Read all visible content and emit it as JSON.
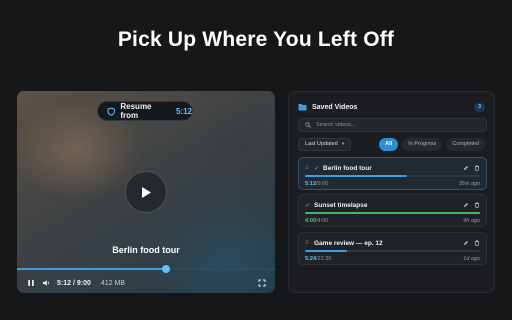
{
  "headline": "Pick Up Where You Left Off",
  "colors": {
    "accent": "#3a9fe0",
    "accent_text": "#5fc1f5",
    "complete": "#3fb56a",
    "background": "#161718"
  },
  "player": {
    "resume_label": "Resume from",
    "resume_time": "5:12",
    "video_title": "Berlin food tour",
    "progress_fraction": 0.578,
    "current_time": "5:12",
    "duration": "9:00",
    "time_separator": " / ",
    "file_size": "412 MB",
    "icons": [
      "shield-icon",
      "play-icon",
      "pause-icon",
      "volume-icon",
      "fullscreen-icon"
    ]
  },
  "panel": {
    "title": "Saved Videos",
    "count": "3",
    "search_placeholder": "Search videos...",
    "sort_label": "Last Updated",
    "filters": [
      {
        "label": "All",
        "active": true
      },
      {
        "label": "In Progress",
        "active": false
      },
      {
        "label": "Completed",
        "active": false
      }
    ],
    "items": [
      {
        "title": "Berlin food tour",
        "position": "5:12",
        "separator": " / ",
        "length": "9:00",
        "ago": "35m ago",
        "progress": 0.58,
        "completed": false,
        "selected": true
      },
      {
        "title": "Sunset timelapse",
        "position": "4:00",
        "separator": " / ",
        "length": "4:00",
        "ago": "4h ago",
        "progress": 1.0,
        "completed": true,
        "selected": false
      },
      {
        "title": "Game review — ep. 12",
        "position": "5:24",
        "separator": " / ",
        "length": "22:30",
        "ago": "1d ago",
        "progress": 0.24,
        "completed": false,
        "selected": false
      }
    ]
  }
}
